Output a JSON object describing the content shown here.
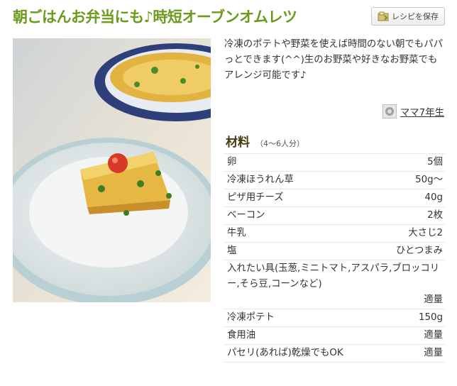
{
  "recipe": {
    "title": "朝ごはんお弁当にも♪時短オーブンオムレツ",
    "save_button": {
      "label": "レシピを保存",
      "icon": "save-recipe-icon"
    },
    "description": "冷凍のポテトや野菜を使えば時間のない朝でもパパっとできます(^^)生のお野菜や好きなお野菜でもアレンジ可能です♪",
    "author": {
      "name": "ママ7年生",
      "icon": "author-avatar"
    }
  },
  "ingredients": {
    "title": "材料",
    "servings": "（4〜6人分）",
    "items": [
      {
        "name": "卵",
        "qty": "5個"
      },
      {
        "name": "冷凍ほうれん草",
        "qty": "50g〜"
      },
      {
        "name": "ピザ用チーズ",
        "qty": "40g"
      },
      {
        "name": "ベーコン",
        "qty": "2枚"
      },
      {
        "name": "牛乳",
        "qty": "大さじ2"
      },
      {
        "name": "塩",
        "qty": "ひとつまみ"
      },
      {
        "name": "入れたい具(玉葱,ミニトマト,アスパラ,ブロッコリー,そら豆,コーンなど)",
        "qty": "適量"
      },
      {
        "name": "冷凍ポテト",
        "qty": "150g"
      },
      {
        "name": "食用油",
        "qty": "適量"
      },
      {
        "name": "パセリ(あれば)乾燥でもOK",
        "qty": "適量"
      }
    ]
  },
  "colors": {
    "title": "#6b9b1a",
    "text": "#333333",
    "heading": "#4a3a10"
  }
}
